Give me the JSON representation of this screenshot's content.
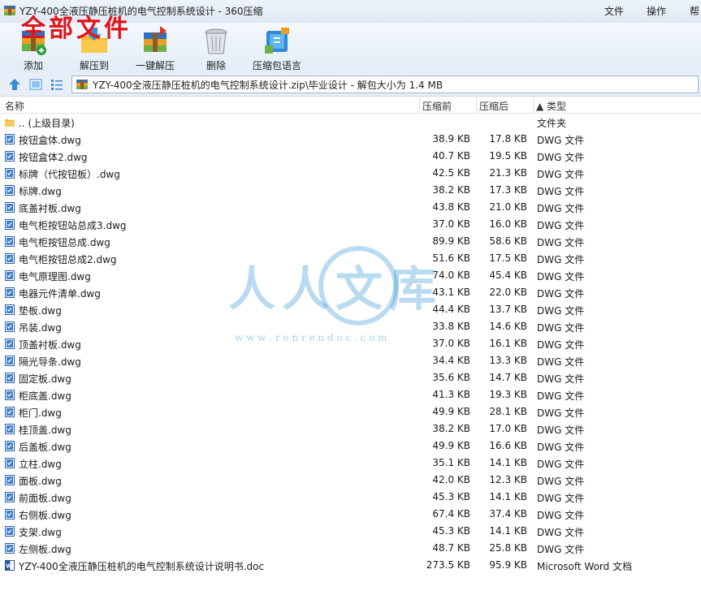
{
  "window": {
    "title": "YZY-400全液压静压桩机的电气控制系统设计 - 360压缩",
    "menu": [
      "文件",
      "操作",
      "帮"
    ]
  },
  "overlay_text": "全部文件",
  "toolbar": {
    "buttons": [
      {
        "label": "添加",
        "icon": "add-archive-icon"
      },
      {
        "label": "解压到",
        "icon": "extract-folder-icon"
      },
      {
        "label": "一键解压",
        "icon": "one-click-extract-icon"
      },
      {
        "label": "删除",
        "icon": "trash-icon"
      },
      {
        "label": "压缩包语言",
        "icon": "archive-language-icon"
      }
    ]
  },
  "address": {
    "path": "YZY-400全液压静压桩机的电气控制系统设计.zip\\毕业设计 - 解包大小为 1.4 MB"
  },
  "columns": {
    "name": "名称",
    "packed": "压缩前",
    "unpacked": "压缩后",
    "type": "▲ 类型"
  },
  "watermark": {
    "brand": "人人文库",
    "url": "w w w . r e n r e n d o c . c o m"
  },
  "files": [
    {
      "name": ".. (上级目录)",
      "packed": "",
      "unpacked": "",
      "type": "文件夹",
      "kind": "folder"
    },
    {
      "name": "按钮盒体.dwg",
      "packed": "38.9 KB",
      "unpacked": "17.8 KB",
      "type": "DWG 文件",
      "kind": "dwg"
    },
    {
      "name": "按钮盒体2.dwg",
      "packed": "40.7 KB",
      "unpacked": "19.5 KB",
      "type": "DWG 文件",
      "kind": "dwg"
    },
    {
      "name": "标牌（代按钮板）.dwg",
      "packed": "42.5 KB",
      "unpacked": "21.3 KB",
      "type": "DWG 文件",
      "kind": "dwg"
    },
    {
      "name": "标牌.dwg",
      "packed": "38.2 KB",
      "unpacked": "17.3 KB",
      "type": "DWG 文件",
      "kind": "dwg"
    },
    {
      "name": "底盖衬板.dwg",
      "packed": "43.8 KB",
      "unpacked": "21.0 KB",
      "type": "DWG 文件",
      "kind": "dwg"
    },
    {
      "name": "电气柜按钮站总成3.dwg",
      "packed": "37.0 KB",
      "unpacked": "16.0 KB",
      "type": "DWG 文件",
      "kind": "dwg"
    },
    {
      "name": "电气柜按钮总成.dwg",
      "packed": "89.9 KB",
      "unpacked": "58.6 KB",
      "type": "DWG 文件",
      "kind": "dwg"
    },
    {
      "name": "电气柜按钮总成2.dwg",
      "packed": "51.6 KB",
      "unpacked": "17.5 KB",
      "type": "DWG 文件",
      "kind": "dwg"
    },
    {
      "name": "电气原理图.dwg",
      "packed": "74.0 KB",
      "unpacked": "45.4 KB",
      "type": "DWG 文件",
      "kind": "dwg"
    },
    {
      "name": "电器元件清单.dwg",
      "packed": "43.1 KB",
      "unpacked": "22.0 KB",
      "type": "DWG 文件",
      "kind": "dwg"
    },
    {
      "name": "垫板.dwg",
      "packed": "44.4 KB",
      "unpacked": "13.7 KB",
      "type": "DWG 文件",
      "kind": "dwg"
    },
    {
      "name": "吊装.dwg",
      "packed": "33.8 KB",
      "unpacked": "14.6 KB",
      "type": "DWG 文件",
      "kind": "dwg"
    },
    {
      "name": "顶盖衬板.dwg",
      "packed": "37.0 KB",
      "unpacked": "16.1 KB",
      "type": "DWG 文件",
      "kind": "dwg"
    },
    {
      "name": "隔光导条.dwg",
      "packed": "34.4 KB",
      "unpacked": "13.3 KB",
      "type": "DWG 文件",
      "kind": "dwg"
    },
    {
      "name": "固定板.dwg",
      "packed": "35.6 KB",
      "unpacked": "14.7 KB",
      "type": "DWG 文件",
      "kind": "dwg"
    },
    {
      "name": "柜底盖.dwg",
      "packed": "41.3 KB",
      "unpacked": "19.3 KB",
      "type": "DWG 文件",
      "kind": "dwg"
    },
    {
      "name": "柜门.dwg",
      "packed": "49.9 KB",
      "unpacked": "28.1 KB",
      "type": "DWG 文件",
      "kind": "dwg"
    },
    {
      "name": "桂顶盖.dwg",
      "packed": "38.2 KB",
      "unpacked": "17.0 KB",
      "type": "DWG 文件",
      "kind": "dwg"
    },
    {
      "name": "后盖板.dwg",
      "packed": "49.9 KB",
      "unpacked": "16.6 KB",
      "type": "DWG 文件",
      "kind": "dwg"
    },
    {
      "name": "立柱.dwg",
      "packed": "35.1 KB",
      "unpacked": "14.1 KB",
      "type": "DWG 文件",
      "kind": "dwg"
    },
    {
      "name": "面板.dwg",
      "packed": "42.0 KB",
      "unpacked": "12.3 KB",
      "type": "DWG 文件",
      "kind": "dwg"
    },
    {
      "name": "前面板.dwg",
      "packed": "45.3 KB",
      "unpacked": "14.1 KB",
      "type": "DWG 文件",
      "kind": "dwg"
    },
    {
      "name": "右侧板.dwg",
      "packed": "67.4 KB",
      "unpacked": "37.4 KB",
      "type": "DWG 文件",
      "kind": "dwg"
    },
    {
      "name": "支架.dwg",
      "packed": "45.3 KB",
      "unpacked": "14.1 KB",
      "type": "DWG 文件",
      "kind": "dwg"
    },
    {
      "name": "左侧板.dwg",
      "packed": "48.7 KB",
      "unpacked": "25.8 KB",
      "type": "DWG 文件",
      "kind": "dwg"
    },
    {
      "name": "YZY-400全液压静压桩机的电气控制系统设计说明书.doc",
      "packed": "273.5 KB",
      "unpacked": "95.9 KB",
      "type": "Microsoft Word 文档",
      "kind": "doc"
    }
  ]
}
